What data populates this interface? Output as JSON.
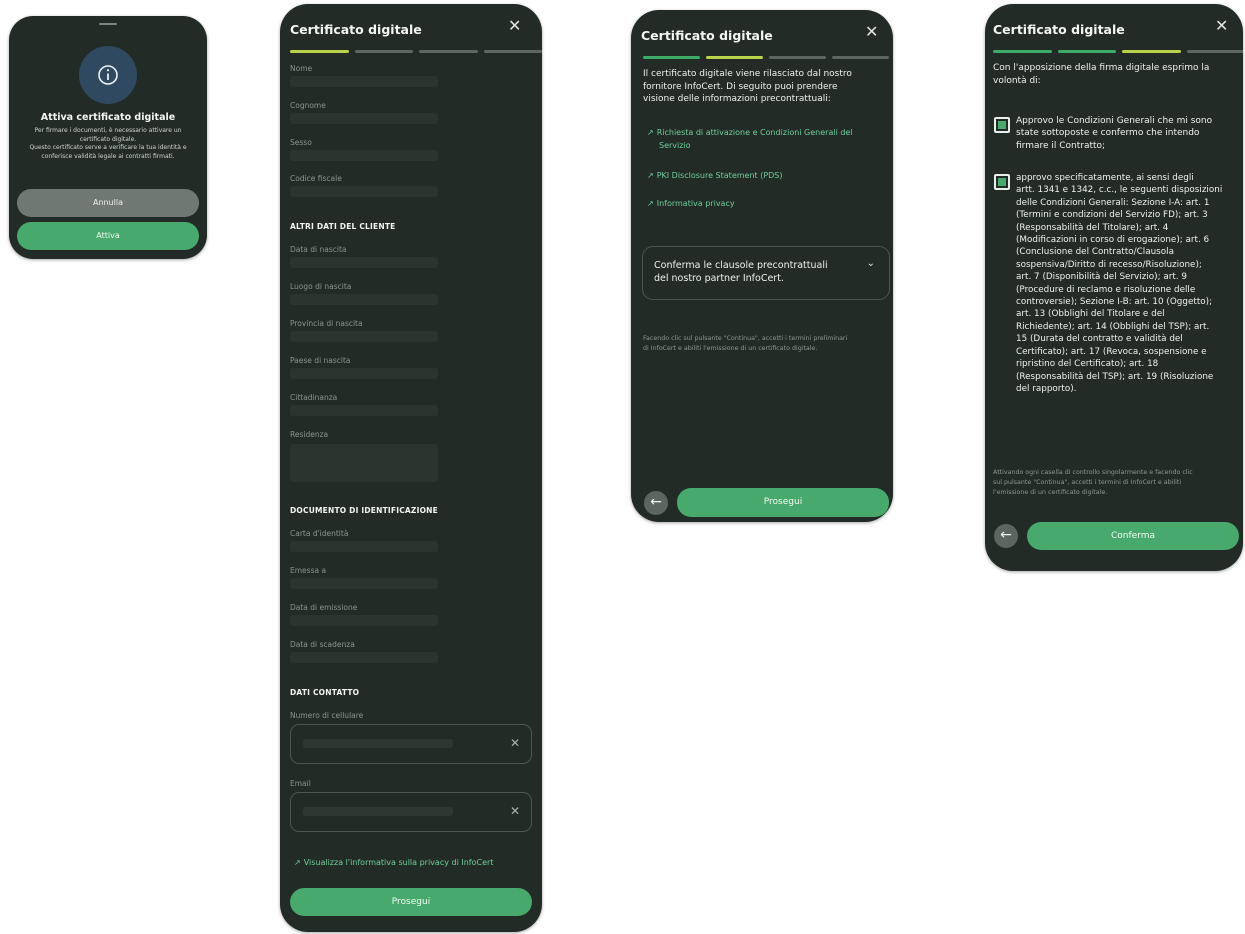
{
  "dialog": {
    "title": "Attiva certificato digitale",
    "body_line1": "Per firmare i documenti, è necessario attivare un",
    "body_line2": "certificato digitale.",
    "body_line3": "Questo certificato serve a verificare la tua identità e",
    "body_line4": "conferisce validità legale ai contratti firmati.",
    "cancel_label": "Annulla",
    "activate_label": "Attiva",
    "info_icon": "info-icon"
  },
  "header": {
    "title": "Certificato digitale",
    "close_icon": "close-icon"
  },
  "form": {
    "fields_top": [
      "Nome",
      "Cognome",
      "Sesso",
      "Codice fiscale"
    ],
    "section_other": "ALTRI DATI DEL CLIENTE",
    "fields_other": [
      "Data di nascita",
      "Luogo di nascita",
      "Provincia di nascita",
      "Paese di nascita",
      "Cittadinanza",
      "Residenza"
    ],
    "section_document": "DOCUMENTO DI IDENTIFICAZIONE",
    "fields_document": [
      "Carta d'identità",
      "Emessa a",
      "Data di emissione",
      "Data di scadenza"
    ],
    "section_contact": "DATI CONTATTO",
    "phone_label": "Numero di cellulare",
    "email_label": "Email",
    "privacy_link": "Visualizza l'informativa sulla privacy di InfoCert",
    "continue_label": "Prosegui"
  },
  "contract_info": {
    "intro_line1": "Il certificato digitale viene rilasciato dal nostro",
    "intro_line2": "fornitore InfoCert. Di seguito puoi prendere",
    "intro_line3": "visione delle informazioni precontrattuali:",
    "link1_line1": "Richiesta di attivazione e Condizioni Generali del",
    "link1_line2": "Servizio",
    "link2": "PKI Disclosure Statement (PDS)",
    "link3": "Informativa privacy",
    "accordion_line1": "Conferma le clausole precontrattuali",
    "accordion_line2": "del nostro partner InfoCert.",
    "note_line1": "Facendo clic sul pulsante \"Continua\", accetti i termini preliminari",
    "note_line2": "di InfoCert e abiliti l'emissione di un certificato digitale.",
    "continue_label": "Prosegui"
  },
  "signature": {
    "intro_line1": "Con l'apposizione della firma digitale esprimo la",
    "intro_line2": "volontà di:",
    "check1": [
      "Approvo le Condizioni Generali che mi sono",
      "state sottoposte e confermo che intendo",
      "firmare il Contratto;"
    ],
    "check2": [
      "approvo specificatamente, ai sensi degli",
      "artt. 1341 e 1342, c.c., le seguenti disposizioni",
      "delle Condizioni Generali: Sezione I-A: art. 1",
      "(Termini e condizioni del Servizio FD); art. 3",
      "(Responsabilità del Titolare); art. 4",
      "(Modificazioni in corso di erogazione); art. 6",
      "(Conclusione del Contratto/Clausola",
      "sospensiva/Diritto di recesso/Risoluzione);",
      "art. 7 (Disponibilità del Servizio); art. 9",
      "(Procedure di reclamo e risoluzione delle",
      "controversie); Sezione I-B: art. 10 (Oggetto);",
      "art. 13 (Obblighi del Titolare e del",
      "Richiedente); art. 14 (Obblighi del TSP); art.",
      "15 (Durata del contratto e validità del",
      "Certificato); art. 17 (Revoca, sospensione e",
      "ripristino del Certificato); art. 18",
      "(Responsabilità del TSP); art. 19 (Risoluzione",
      "del rapporto)."
    ],
    "note_line1": "Attivando ogni casella di controllo singolarmente e facendo clic",
    "note_line2": "sul pulsante \"Continua\", accetti i termini di InfoCert e abiliti",
    "note_line3": "l'emissione di un certificato digitale.",
    "confirm_label": "Conferma"
  },
  "colors": {
    "background": "#232b26",
    "accent": "#47a96b",
    "progress_active": "#b7d44a",
    "link": "#6fd09a"
  }
}
